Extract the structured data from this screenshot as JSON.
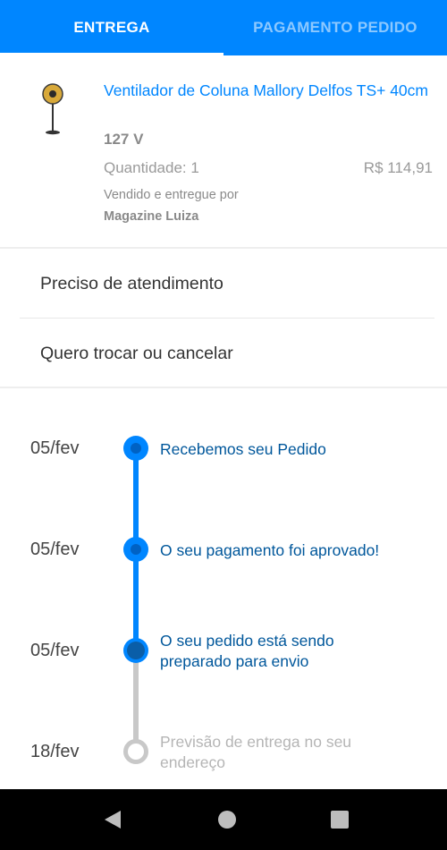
{
  "tabs": [
    {
      "label": "ENTREGA",
      "active": true
    },
    {
      "label": "PAGAMENTO PEDIDO",
      "active": false
    }
  ],
  "product": {
    "title": "Ventilador de Coluna Mallory Delfos TS+ 40cm",
    "voltage": "127 V",
    "quantity": "Quantidade: 1",
    "price": "R$ 114,91",
    "sold_by": "Vendido e entregue por",
    "seller": "Magazine Luiza",
    "thumbnail_icon": "standing-fan-icon"
  },
  "actions": {
    "help": "Preciso de atendimento",
    "exchange": "Quero trocar ou cancelar"
  },
  "timeline": [
    {
      "date": "05/fev",
      "text": "Recebemos seu Pedido",
      "status": "done"
    },
    {
      "date": "05/fev",
      "text": "O seu pagamento foi aprovado!",
      "status": "done"
    },
    {
      "date": "05/fev",
      "text": "O seu pedido está sendo preparado para envio",
      "status": "current"
    },
    {
      "date": "18/fev",
      "text": "Previsão de entrega no seu endereço",
      "status": "pending"
    }
  ],
  "navbar": {
    "back_icon": "back-triangle-icon",
    "home_icon": "home-circle-icon",
    "recents_icon": "recents-square-icon"
  },
  "colors": {
    "accent": "#0086ff",
    "timeline_text": "#00579b",
    "pending": "#c8c8c8"
  }
}
